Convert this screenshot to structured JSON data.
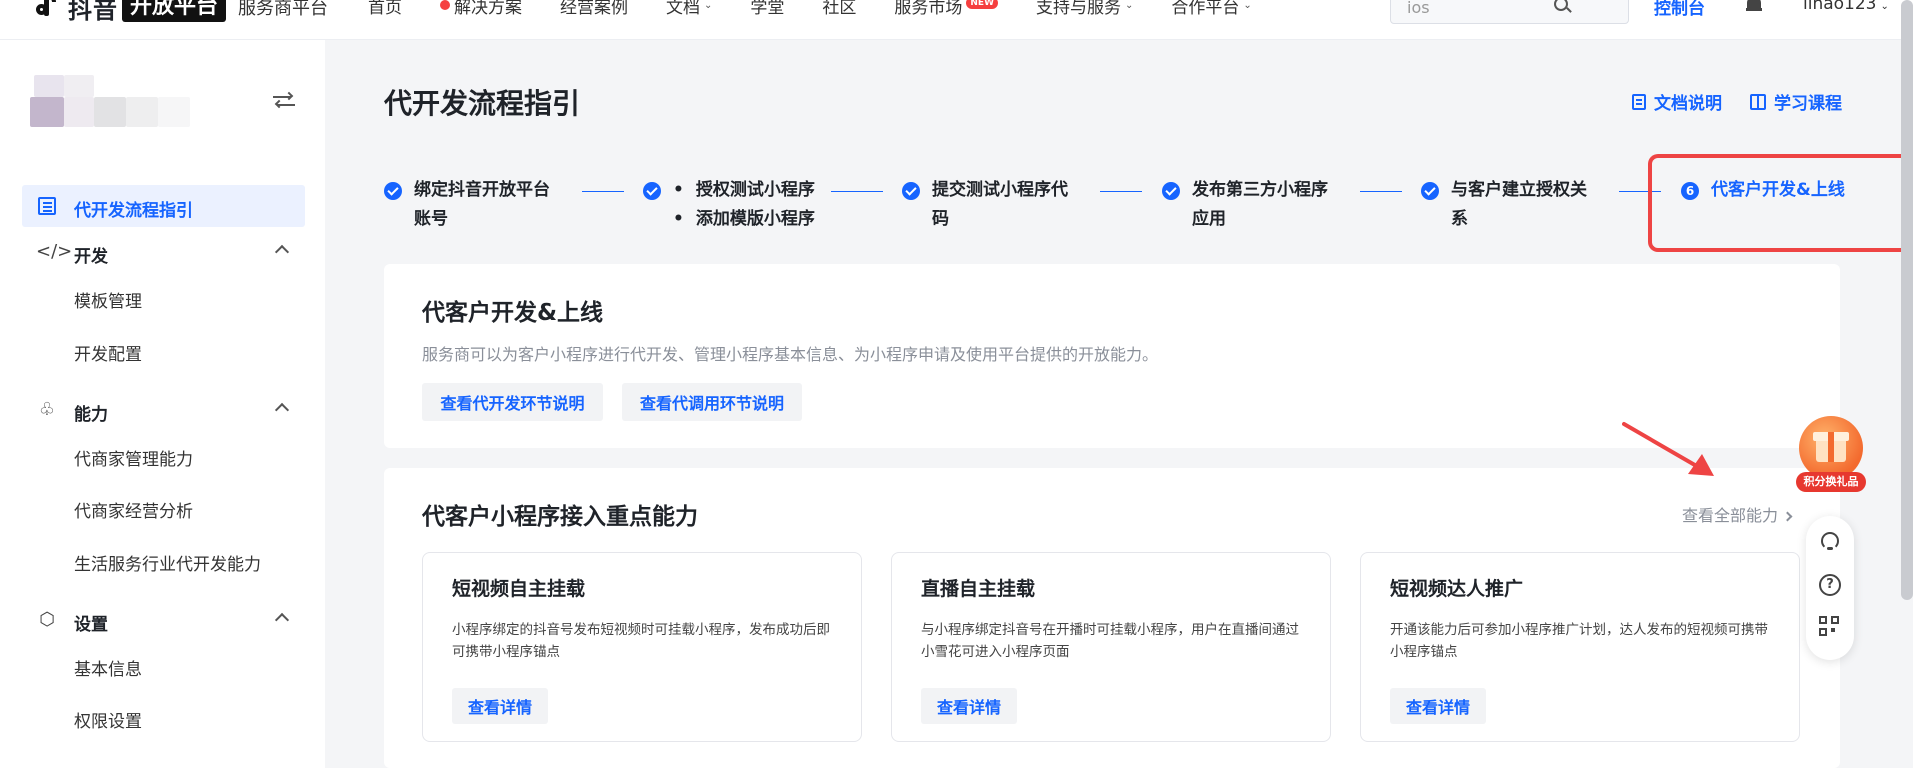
{
  "topnav": {
    "logo_text": "抖音",
    "logo_badge": "开放平台",
    "logo_sub": "服务商平台",
    "items": [
      {
        "label": "首页"
      },
      {
        "label": "解决方案",
        "dot": true
      },
      {
        "label": "经营案例"
      },
      {
        "label": "文档",
        "dropdown": true
      },
      {
        "label": "学堂"
      },
      {
        "label": "社区"
      },
      {
        "label": "服务市场",
        "badge": "NEW"
      },
      {
        "label": "支持与服务",
        "dropdown": true
      },
      {
        "label": "合作平台",
        "dropdown": true
      }
    ],
    "search_value": "ios",
    "console_label": "控制台",
    "username": "lihao123"
  },
  "sidebar": {
    "active_item": "代开发流程指引",
    "groups": [
      {
        "label": "开发",
        "icon": "code-icon",
        "items": [
          "模板管理",
          "开发配置"
        ]
      },
      {
        "label": "能力",
        "icon": "ability-icon",
        "items": [
          "代商家管理能力",
          "代商家经营分析",
          "生活服务行业代开发能力"
        ]
      },
      {
        "label": "设置",
        "icon": "settings-icon",
        "items": [
          "基本信息",
          "权限设置"
        ]
      }
    ]
  },
  "main": {
    "title": "代开发流程指引",
    "doc_link": "文档说明",
    "course_link": "学习课程",
    "steps": [
      {
        "line1": "绑定抖音开放平台",
        "line2": "账号",
        "done": true
      },
      {
        "bullet1": "授权测试小程序",
        "bullet2": "添加模版小程序",
        "done": true
      },
      {
        "line1": "提交测试小程序代",
        "line2": "码",
        "done": true
      },
      {
        "line1": "发布第三方小程序",
        "line2": "应用",
        "done": true
      },
      {
        "line1": "与客户建立授权关",
        "line2": "系",
        "done": true
      },
      {
        "line1": "代客户开发&上线",
        "number": "6",
        "active": true
      }
    ],
    "intro_card": {
      "title": "代客户开发&上线",
      "desc": "服务商可以为客户小程序进行代开发、管理小程序基本信息、为小程序申请及使用平台提供的开放能力。",
      "btn1": "查看代开发环节说明",
      "btn2": "查看代调用环节说明"
    },
    "ability_card": {
      "title": "代客户小程序接入重点能力",
      "view_all": "查看全部能力",
      "features": [
        {
          "title": "短视频自主挂载",
          "desc": "小程序绑定的抖音号发布短视频时可挂载小程序，发布成功后即可携带小程序锚点",
          "btn": "查看详情"
        },
        {
          "title": "直播自主挂载",
          "desc": "与小程序绑定抖音号在开播时可挂载小程序，用户在直播间通过小雪花可进入小程序页面",
          "btn": "查看详情"
        },
        {
          "title": "短视频达人推广",
          "desc": "开通该能力后可参加小程序推广计划，达人发布的短视频可携带小程序锚点",
          "btn": "查看详情"
        }
      ]
    }
  },
  "floating": {
    "gift_label": "积分换礼品"
  },
  "colors": {
    "accent": "#1664ff",
    "highlight": "#ee4444"
  }
}
